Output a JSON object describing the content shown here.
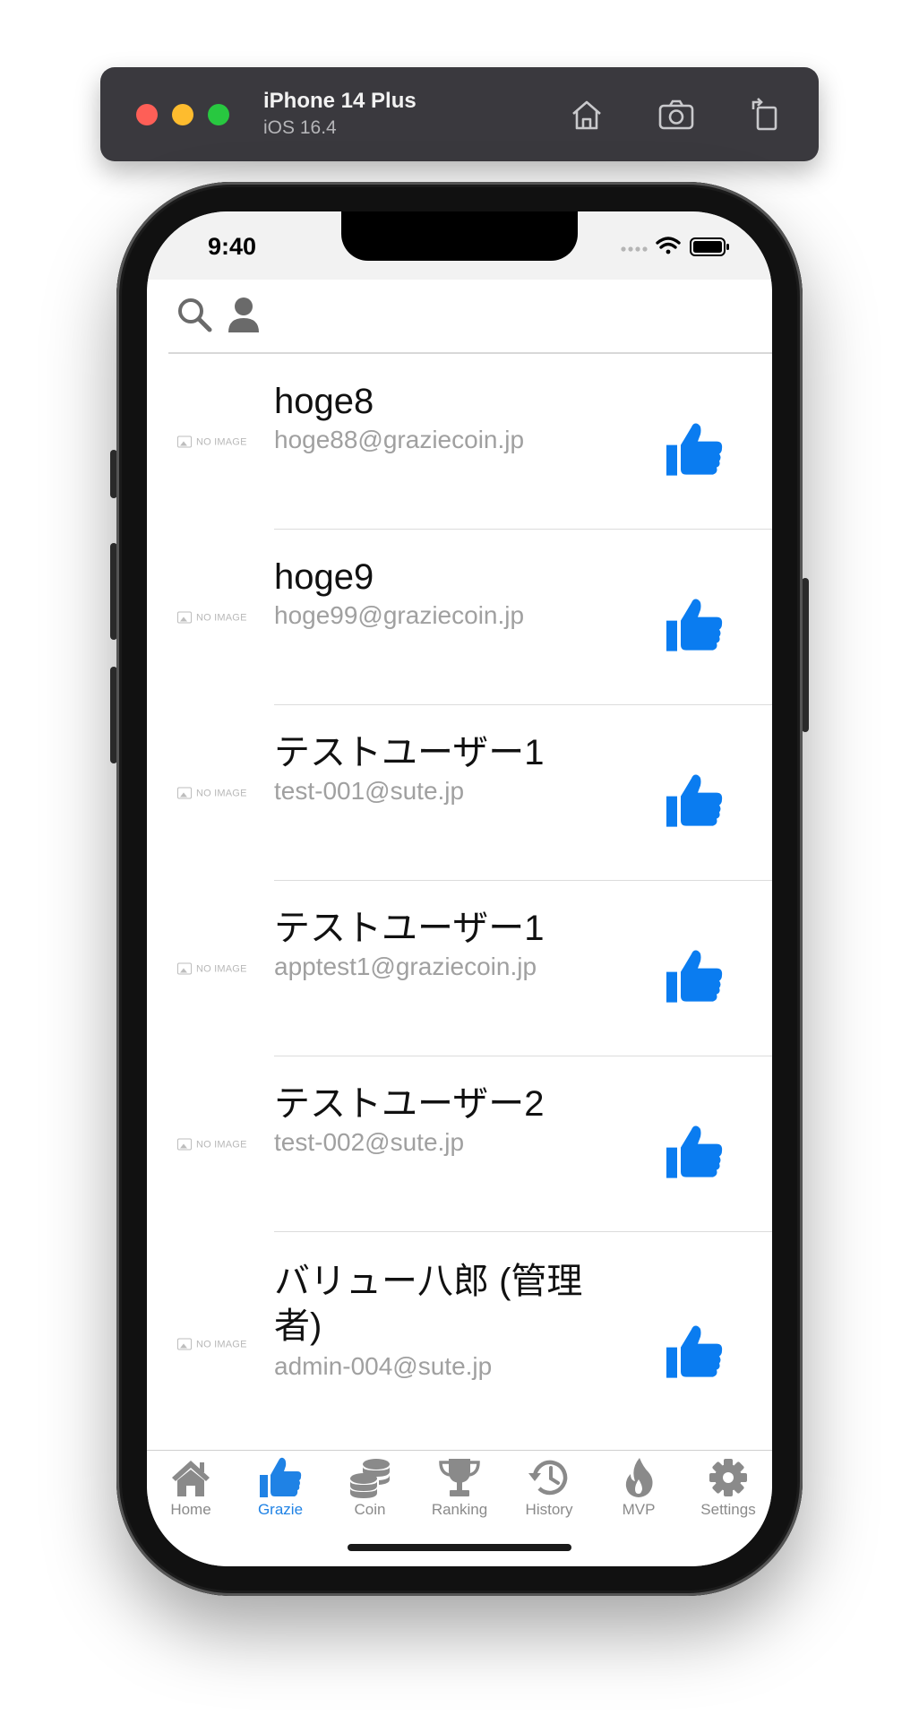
{
  "simulator": {
    "device": "iPhone 14 Plus",
    "os": "iOS 16.4"
  },
  "status_bar": {
    "time": "9:40"
  },
  "users": [
    {
      "name": "hoge8",
      "email": "hoge88@graziecoin.jp",
      "image": "NO IMAGE"
    },
    {
      "name": "hoge9",
      "email": "hoge99@graziecoin.jp",
      "image": "NO IMAGE"
    },
    {
      "name": "テストユーザー1",
      "email": "test-001@sute.jp",
      "image": "NO IMAGE"
    },
    {
      "name": "テストユーザー1",
      "email": "apptest1@graziecoin.jp",
      "image": "NO IMAGE"
    },
    {
      "name": "テストユーザー2",
      "email": "test-002@sute.jp",
      "image": "NO IMAGE"
    },
    {
      "name": "バリュー八郎 (管理者)",
      "email": "admin-004@sute.jp",
      "image": "NO IMAGE"
    }
  ],
  "tabs": [
    {
      "label": "Home",
      "icon": "home-icon"
    },
    {
      "label": "Grazie",
      "icon": "thumbs-up-icon",
      "active": true
    },
    {
      "label": "Coin",
      "icon": "coins-icon"
    },
    {
      "label": "Ranking",
      "icon": "trophy-icon"
    },
    {
      "label": "History",
      "icon": "history-icon"
    },
    {
      "label": "MVP",
      "icon": "fire-icon"
    },
    {
      "label": "Settings",
      "icon": "gear-icon"
    }
  ],
  "colors": {
    "accent": "#1f82e5",
    "like": "#0a7cf0",
    "inactive_tab": "#8a8a8a"
  }
}
